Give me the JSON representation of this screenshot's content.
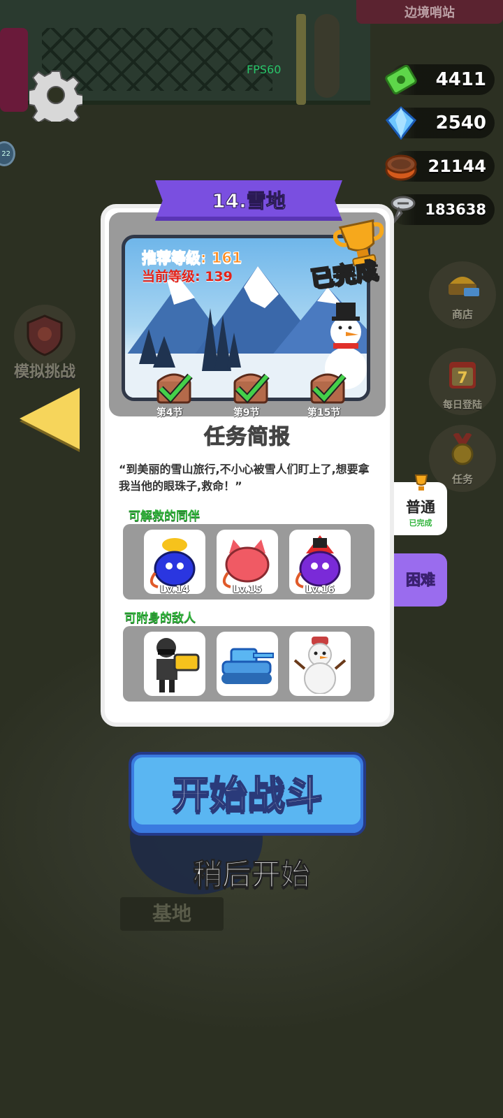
{
  "hud": {
    "sign": "边境哨站",
    "fps": "FPS60",
    "badge_num": "22",
    "currencies": [
      {
        "name": "cash",
        "icon": "cash-icon",
        "value": "4411"
      },
      {
        "name": "gems",
        "icon": "diamond-icon",
        "value": "2540"
      },
      {
        "name": "canned-food",
        "icon": "can-icon",
        "value": "21144"
      },
      {
        "name": "screws",
        "icon": "screw-icon",
        "value": "183638"
      }
    ]
  },
  "left": {
    "sim_label": "模拟挑战"
  },
  "right": {
    "shop": "商店",
    "daily": "每日登陆",
    "daily_num": "7",
    "task": "任务"
  },
  "level": {
    "title": "14.雪地",
    "recommended": "推荐等级: 161",
    "current": "当前等级: 139",
    "status": "已完成",
    "sections": [
      "第4节",
      "第9节",
      "第15节"
    ],
    "brief_title": "任务简报",
    "brief_text": "“到美丽的雪山旅行,不小心被雪人们盯上了,想要拿我当他的眼珠子,救命！”",
    "companions_title": "可解救的同伴",
    "companions": [
      {
        "level": "Lv.14"
      },
      {
        "level": "Lv.15"
      },
      {
        "level": "Lv.16"
      }
    ],
    "enemies_title": "可附身的敌人"
  },
  "difficulty": {
    "normal": "普通",
    "normal_status": "已完成",
    "hard": "困难"
  },
  "actions": {
    "start": "开始战斗",
    "later": "稍后开始",
    "base": "基地"
  },
  "colors": {
    "ribbon": "#7a4fe0",
    "start_button": "#5ab6f2",
    "arrow": "#f6d55b",
    "hard_tab": "#9a6cee"
  }
}
